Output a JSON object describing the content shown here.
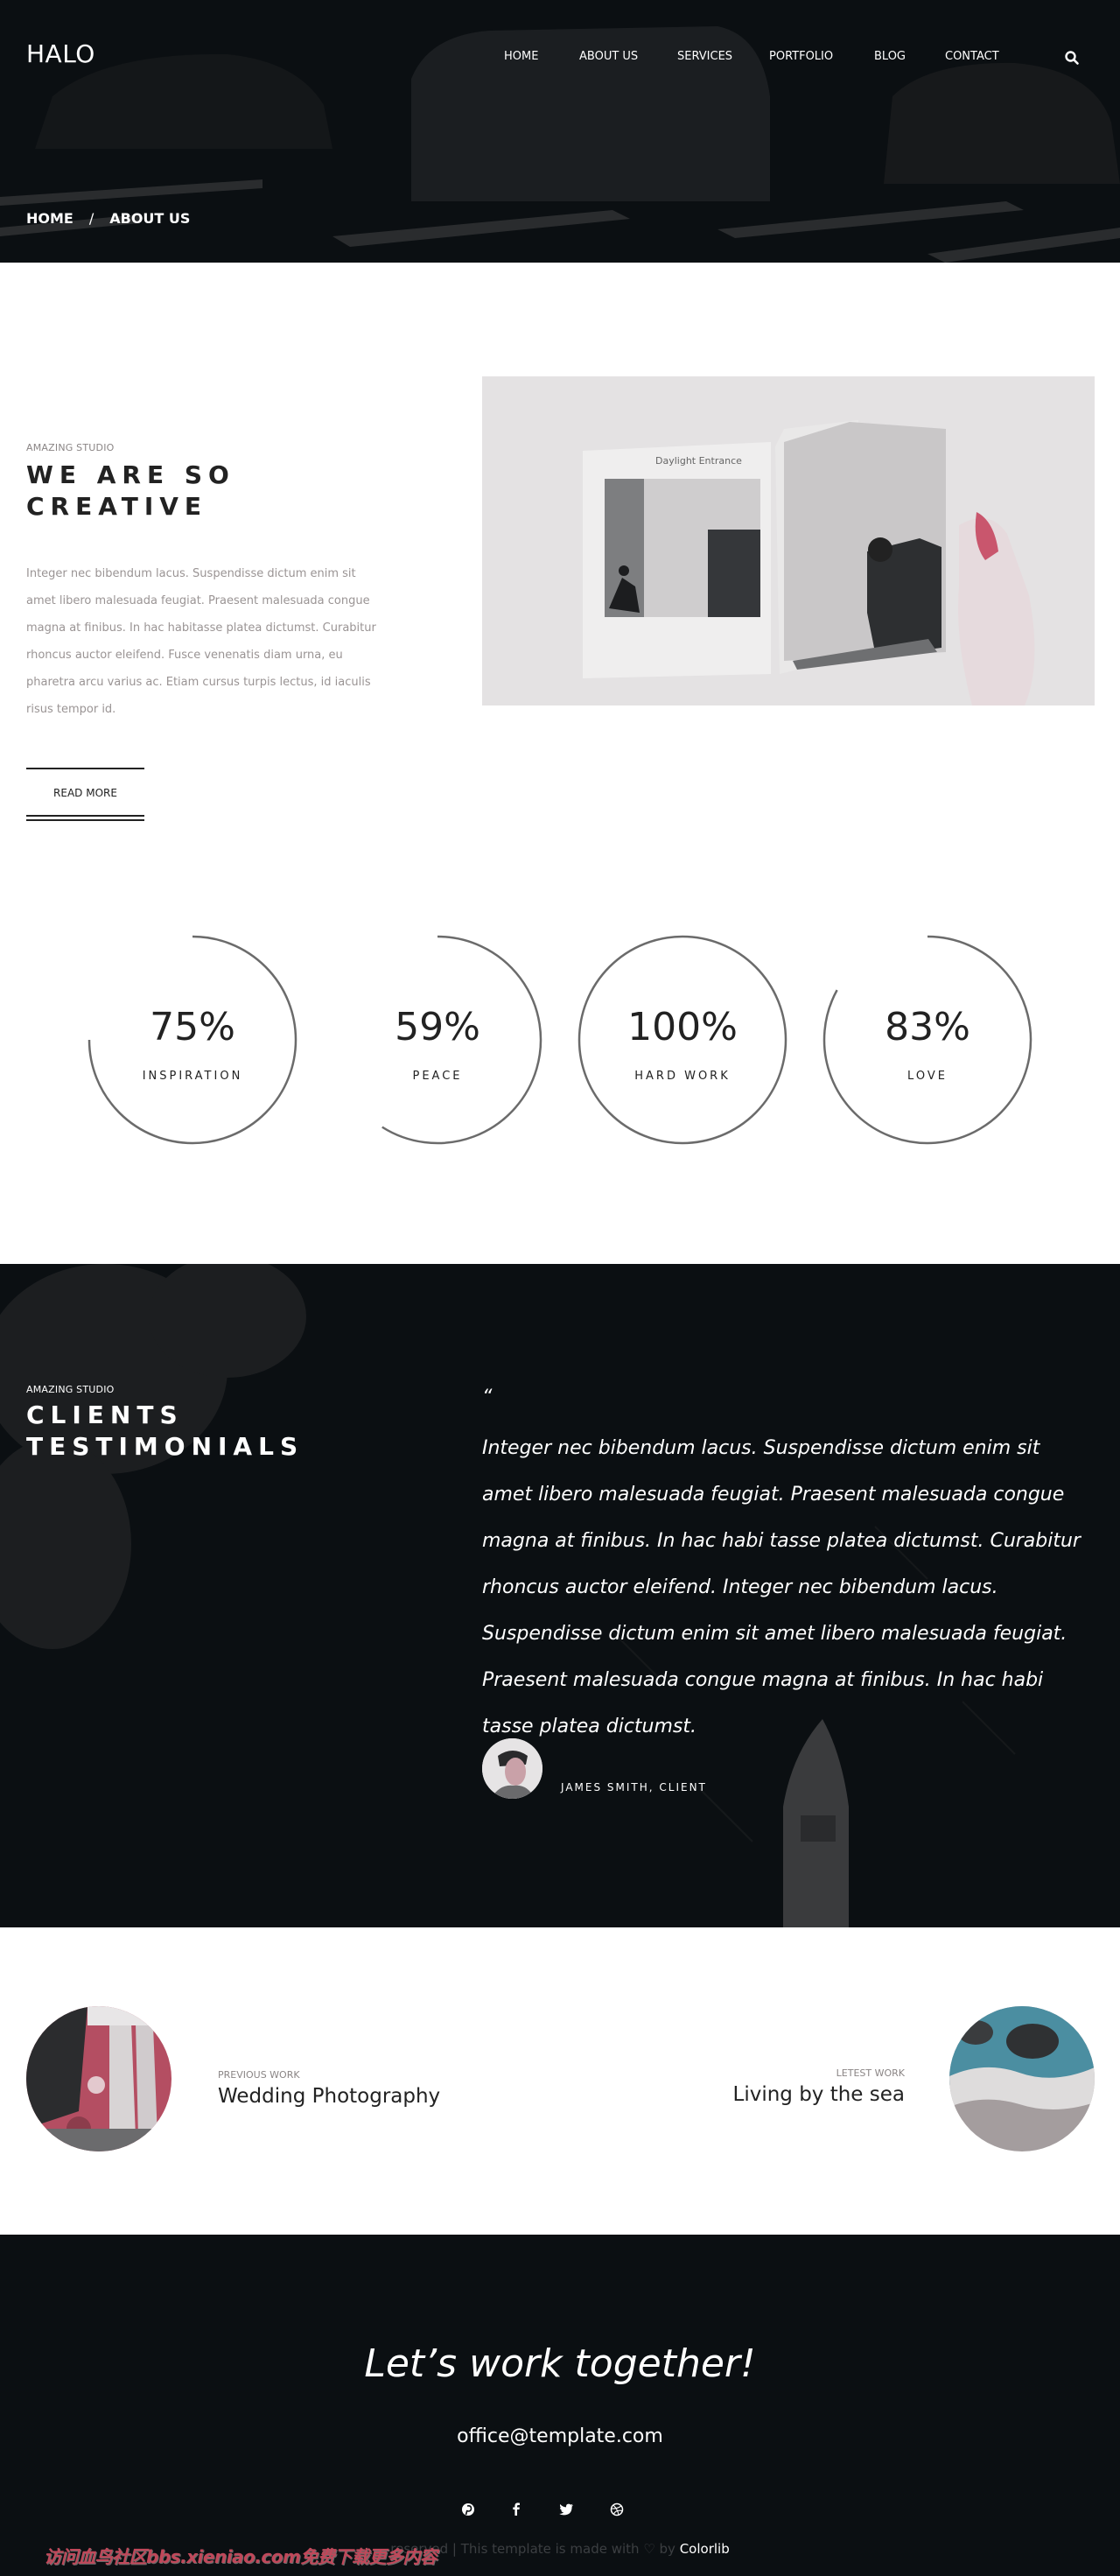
{
  "header": {
    "logo": "HALO",
    "nav": [
      {
        "label": "HOME"
      },
      {
        "label": "ABOUT US"
      },
      {
        "label": "SERVICES"
      },
      {
        "label": "PORTFOLIO"
      },
      {
        "label": "BLOG"
      },
      {
        "label": "CONTACT"
      }
    ],
    "search_icon": "search-icon",
    "breadcrumb": {
      "home": "HOME",
      "separator": "/",
      "current": "ABOUT US"
    }
  },
  "about": {
    "eyebrow": "AMAZING STUDIO",
    "heading_line1": "WE ARE SO",
    "heading_line2": "CREATIVE",
    "body": "Integer nec bibendum lacus. Suspendisse dictum enim sit amet libero malesuada feugiat. Praesent malesuada congue magna at finibus. In hac habitasse platea dictumst. Curabitur rhoncus auctor eleifend. Fusce venenatis diam urna, eu pharetra arcu varius ac. Etiam cursus turpis lectus, id iaculis risus tempor id.",
    "read_more": "READ MORE",
    "image_caption": "Daylight Entrance"
  },
  "stats": [
    {
      "value": "75%",
      "label": "INSPIRATION",
      "fraction": 0.75
    },
    {
      "value": "59%",
      "label": "PEACE",
      "fraction": 0.59
    },
    {
      "value": "100%",
      "label": "HARD WORK",
      "fraction": 1.0
    },
    {
      "value": "83%",
      "label": "LOVE",
      "fraction": 0.83
    }
  ],
  "testimonials": {
    "eyebrow": "AMAZING STUDIO",
    "heading_line1": "CLIENTS",
    "heading_line2": "TESTIMONIALS",
    "quote_mark": "“",
    "quote": "Integer nec bibendum lacus. Suspendisse dictum enim sit amet libero malesuada feugiat. Praesent malesuada congue magna at finibus. In hac habi tasse platea dictumst. Curabitur rhoncus auctor eleifend. Integer nec bibendum lacus. Suspendisse dictum enim sit amet libero malesuada feugiat. Praesent malesuada congue magna at finibus. In hac habi tasse platea dictumst.",
    "client": "JAMES SMITH, CLIENT"
  },
  "works": {
    "previous": {
      "eyebrow": "PREVIOUS WORK",
      "title": "Wedding Photography"
    },
    "latest": {
      "eyebrow": "LETEST WORK",
      "title": "Living by the sea"
    }
  },
  "footer": {
    "cta": "Let’s work together!",
    "email": "office@template.com",
    "social": [
      "pinterest-icon",
      "facebook-icon",
      "twitter-icon",
      "dribbble-icon"
    ],
    "copyright": "reserved | This template is made with ♡ by",
    "brand": "Colorlib",
    "watermark": "访问血鸟社区bbs.xieniao.com免费下载更多内容"
  }
}
